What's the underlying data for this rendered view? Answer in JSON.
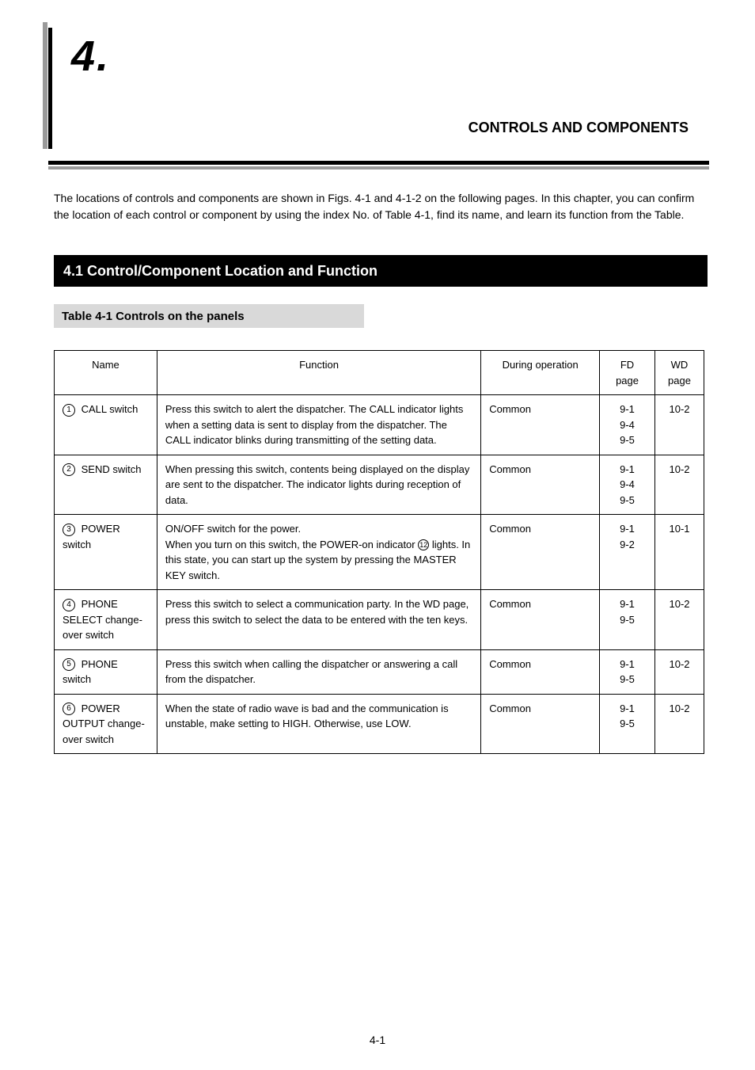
{
  "header": {
    "chapter_number": "4.",
    "chapter_title": "CONTROLS AND COMPONENTS"
  },
  "intro": "The locations of controls and components are shown in Figs. 4-1 and 4-1-2 on the following pages. In this chapter, you can confirm the location of each control or component by using the index No. of Table 4-1, find its name, and learn its function from the Table.",
  "section_bar": "4.1 Control/Component Location and Function",
  "subsection_bar": "Table 4-1 Controls on the panels",
  "table": {
    "headers": [
      "Name",
      "Function",
      "During operation",
      "FD page",
      "WD page"
    ],
    "rows": [
      {
        "num": "1",
        "name": "CALL switch",
        "function": "Press this switch to alert the dispatcher. The CALL indicator lights when a setting data is sent to display from the dispatcher. The CALL indicator blinks during transmitting of the setting data.",
        "during": "Common",
        "fd": "9-1\n9-4\n9-5",
        "wd": "10-2"
      },
      {
        "num": "2",
        "name": "SEND switch",
        "function": "When pressing this switch, contents being displayed on the display are sent to the dispatcher. The indicator lights during reception of data.",
        "during": "Common",
        "fd": "9-1\n9-4\n9-5",
        "wd": "10-2"
      },
      {
        "num": "3",
        "name": "POWER switch",
        "function_prefix": "ON/OFF switch for the power.\nWhen you turn on this switch, the POWER-on indicator ",
        "function_circled": "12",
        "function_suffix": " lights. In this state, you can start up the system by pressing the MASTER KEY switch.",
        "during": "Common",
        "fd": "9-1\n9-2",
        "wd": "10-1"
      },
      {
        "num": "4",
        "name": "PHONE SELECT change-over switch",
        "function": "Press this switch to select a communication party. In the WD page, press this switch to select the data to be entered with the ten keys.",
        "during": "Common",
        "fd": "9-1\n9-5",
        "wd": "10-2"
      },
      {
        "num": "5",
        "name": "PHONE switch",
        "function": "Press this switch when calling the dispatcher or answering a call from the dispatcher.",
        "during": "Common",
        "fd": "9-1\n9-5",
        "wd": "10-2"
      },
      {
        "num": "6",
        "name": "POWER OUTPUT change-over switch",
        "function": "When the state of radio wave is bad and the communication is unstable, make setting to HIGH. Otherwise, use LOW.",
        "during": "Common",
        "fd": "9-1\n9-5",
        "wd": "10-2"
      }
    ]
  },
  "page_number": "4-1"
}
